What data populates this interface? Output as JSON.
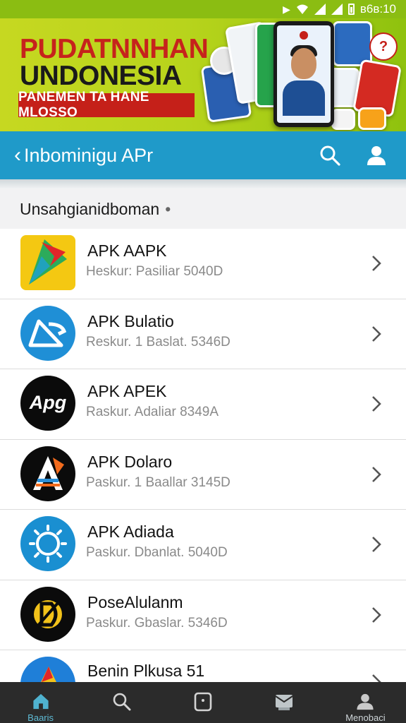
{
  "status_bar": {
    "time": "ʙ6ʙ:10"
  },
  "banner": {
    "title_line1": "PUDATNNHAN",
    "title_line2": "UNDONESIA",
    "ribbon_text": "PANEMEN TA HANE MLOSSO"
  },
  "app_bar": {
    "back_label": "Inbominigu APr",
    "icons": [
      "back-chevron-icon",
      "search-icon",
      "user-icon"
    ],
    "color": "#1f9ac9"
  },
  "section": {
    "title": "Unsahgianidboman",
    "dot": "•"
  },
  "apps": [
    {
      "name": "APK AAPK",
      "sub": "Heskur: Pasiliar 5040D",
      "icon": "red-flag-app-icon"
    },
    {
      "name": "APK Bulatio",
      "sub": "Reskur. 1 Baslat. 5346D",
      "icon": "triangle-app-icon"
    },
    {
      "name": "APK APEK",
      "sub": "Raskur. Adaliar 8349A",
      "icon": "apg-app-icon",
      "icon_text": "Apg"
    },
    {
      "name": "APK Dolaro",
      "sub": "Paskur. 1 Baallar 3145D",
      "icon": "a-letter-app-icon"
    },
    {
      "name": "APK Adiada",
      "sub": "Paskur. Dbanlat. 5040D",
      "icon": "sun-app-icon"
    },
    {
      "name": "PoseAlulanm",
      "sub": "Paskur. Gbaslar. 5346D",
      "icon": "yellow-d-app-icon"
    },
    {
      "name": "Benin Plkusa 51",
      "sub": "",
      "icon": "blue-triangle-app-icon"
    }
  ],
  "bottom_nav": {
    "items": [
      {
        "label": "Baaris",
        "icon": "home-icon",
        "active": true
      },
      {
        "label": "",
        "icon": "search-icon",
        "active": false
      },
      {
        "label": "",
        "icon": "tablet-icon",
        "active": false
      },
      {
        "label": "",
        "icon": "inbox-icon",
        "active": false
      },
      {
        "label": "Menobaci",
        "icon": "person-icon",
        "active": false
      }
    ],
    "active_color": "#5fbcd6"
  }
}
